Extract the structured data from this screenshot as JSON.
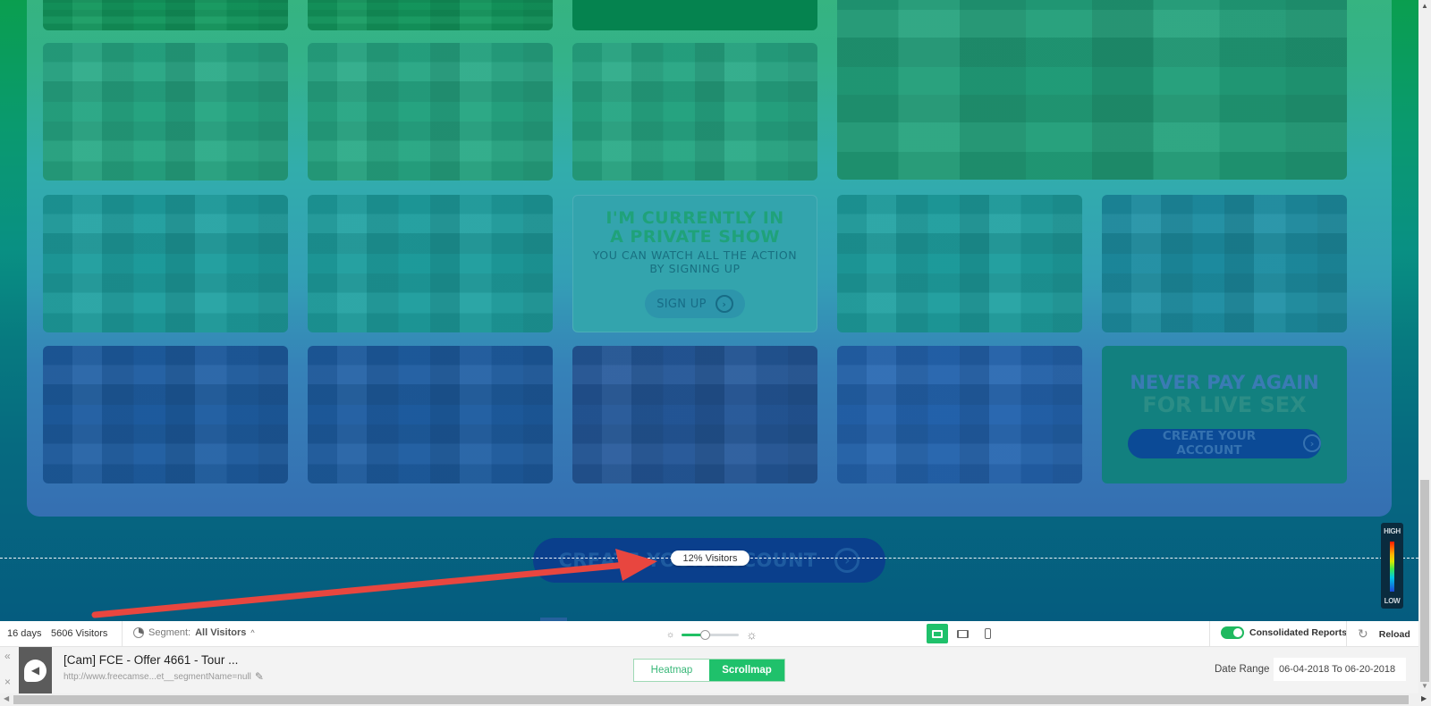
{
  "heatmap": {
    "promo_private": {
      "headline": "I'M CURRENTLY IN A PRIVATE SHOW",
      "subline": "YOU CAN WATCH ALL THE ACTION BY SIGNING UP",
      "button": "SIGN UP"
    },
    "promo_never_pay": {
      "line1": "NEVER PAY AGAIN",
      "line2": "FOR LIVE SEX",
      "button": "CREATE YOUR ACCOUNT"
    },
    "cta_button": "CREATE YOUR ACCOUNT",
    "scroll_marker": {
      "label": "12% Visitors",
      "percent": 12
    },
    "legend": {
      "high": "HIGH",
      "low": "LOW"
    }
  },
  "toolbar": {
    "days": "16 days",
    "visitors": "5606 Visitors",
    "segment_prefix": "Segment:",
    "segment_value": "All Visitors",
    "brightness_level": 0.4,
    "devices": [
      {
        "name": "desktop",
        "active": true
      },
      {
        "name": "tablet",
        "active": false
      },
      {
        "name": "mobile",
        "active": false
      }
    ],
    "consolidated_label": "Consolidated Reports",
    "consolidated_on": true,
    "reload_label": "Reload"
  },
  "report": {
    "title": "[Cam] FCE - Offer 4661 - Tour ...",
    "url": "http://www.freecamse...et__segmentName=null",
    "tabs": [
      {
        "label": "Heatmap",
        "active": false
      },
      {
        "label": "Scrollmap",
        "active": true
      }
    ],
    "date_range_label": "Date Range",
    "date_range_value": "06-04-2018 To 06-20-2018"
  },
  "colors": {
    "accent_green": "#1fc16b",
    "annotation_arrow": "#e8463f"
  }
}
